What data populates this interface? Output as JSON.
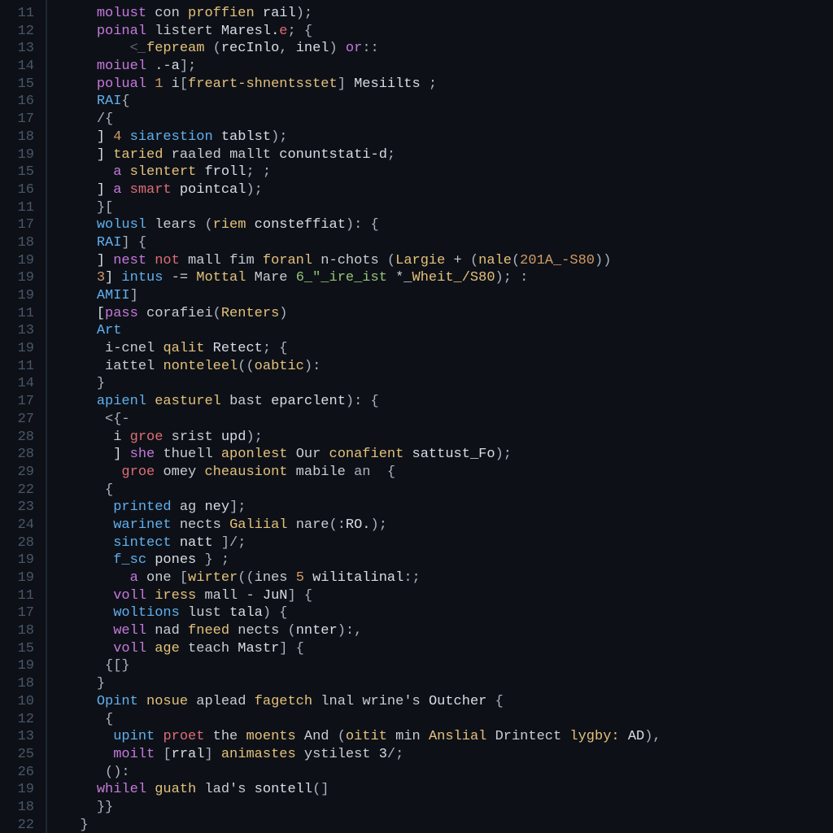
{
  "editor": {
    "gutter": [
      "11",
      "12",
      "13",
      "14",
      "15",
      "16",
      "17",
      "18",
      "19",
      "15",
      "16",
      "11",
      "17",
      "18",
      "19",
      "19",
      "19",
      "11",
      "13",
      "19",
      "11",
      "14",
      "17",
      "27",
      "28",
      "28",
      "29",
      "22",
      "23",
      "24",
      "28",
      "19",
      "19",
      "11",
      "17",
      "18",
      "15",
      "19",
      "18",
      "10",
      "12",
      "13",
      "25",
      "26",
      "19",
      "18",
      "22"
    ],
    "lines": [
      [
        [
          "    ",
          ""
        ],
        [
          "molust ",
          "kw"
        ],
        [
          "con ",
          "op"
        ],
        [
          "proffien ",
          "fn"
        ],
        [
          "rail",
          ""
        ],
        [
          ");",
          "pn"
        ]
      ],
      [
        [
          "    ",
          ""
        ],
        [
          "poinal ",
          "kw"
        ],
        [
          "listert ",
          "op"
        ],
        [
          "Maresl.",
          ""
        ],
        [
          "e",
          "id"
        ],
        [
          "; {",
          "pn"
        ]
      ],
      [
        [
          "        ",
          ""
        ],
        [
          "<_",
          "cm"
        ],
        [
          "fepream ",
          "fn"
        ],
        [
          "(",
          "pn"
        ],
        [
          "recInlo",
          ""
        ],
        [
          ", ",
          "pn"
        ],
        [
          "inel",
          ""
        ],
        [
          ") ",
          "pn"
        ],
        [
          "or",
          "kw"
        ],
        [
          "::",
          "pn"
        ]
      ],
      [
        [
          "    ",
          ""
        ],
        [
          "moiuel ",
          "kw"
        ],
        [
          ".-",
          "op"
        ],
        [
          "a",
          ""
        ],
        [
          "];",
          "pn"
        ]
      ],
      [
        [
          "    ",
          ""
        ],
        [
          "polual ",
          "kw"
        ],
        [
          "1 ",
          "num"
        ],
        [
          "i",
          "op"
        ],
        [
          "[",
          "pn"
        ],
        [
          "freart-shnentsstet",
          "fn"
        ],
        [
          "] ",
          "pn"
        ],
        [
          "Mesiilts ",
          ""
        ],
        [
          ";",
          "pn"
        ]
      ],
      [
        [
          "    ",
          ""
        ],
        [
          "RAI",
          "kw2"
        ],
        [
          "{",
          "pn"
        ]
      ],
      [
        [
          "    ",
          ""
        ],
        [
          "/{",
          "pn"
        ]
      ],
      [
        [
          "    ] ",
          ""
        ],
        [
          "4 ",
          "num"
        ],
        [
          "siarestion ",
          "kw2"
        ],
        [
          "tablst",
          ""
        ],
        [
          ");",
          "pn"
        ]
      ],
      [
        [
          "    ] ",
          ""
        ],
        [
          "taried ",
          "fn"
        ],
        [
          "raaled ",
          "op"
        ],
        [
          "mallt ",
          "op"
        ],
        [
          "conuntstati-d",
          ""
        ],
        [
          ";",
          "pn"
        ]
      ],
      [
        [
          "      ",
          ""
        ],
        [
          "a ",
          "kw"
        ],
        [
          "slentert ",
          "fn"
        ],
        [
          "froll",
          ""
        ],
        [
          "; ;",
          "pn"
        ]
      ],
      [
        [
          "    ] ",
          ""
        ],
        [
          "a ",
          "kw"
        ],
        [
          "smart ",
          "id"
        ],
        [
          "pointcal",
          ""
        ],
        [
          ");",
          "pn"
        ]
      ],
      [
        [
          "    ",
          ""
        ],
        [
          "}[",
          "pn"
        ]
      ],
      [
        [
          "    ",
          ""
        ],
        [
          "wolusl ",
          "kw2"
        ],
        [
          "lears ",
          "op"
        ],
        [
          "(",
          "pn"
        ],
        [
          "riem ",
          "fn"
        ],
        [
          "consteffiat",
          ""
        ],
        [
          "): {",
          "pn"
        ]
      ],
      [
        [
          "    ",
          ""
        ],
        [
          "RAI",
          "kw2"
        ],
        [
          "] {",
          "pn"
        ]
      ],
      [
        [
          "    ] ",
          ""
        ],
        [
          "nest ",
          "kw"
        ],
        [
          "not ",
          "id"
        ],
        [
          "mall ",
          "op"
        ],
        [
          "fim ",
          "op"
        ],
        [
          "foranl ",
          "fn"
        ],
        [
          "n-chots ",
          "op"
        ],
        [
          "(",
          "pn"
        ],
        [
          "Largie ",
          "fn"
        ],
        [
          "+ ",
          "op"
        ],
        [
          "(",
          "pn"
        ],
        [
          "nale",
          "fn"
        ],
        [
          "(",
          "pn"
        ],
        [
          "201A_-S80",
          "num"
        ],
        [
          "))",
          "pn"
        ]
      ],
      [
        [
          "    ",
          ""
        ],
        [
          "3",
          "num"
        ],
        [
          "] ",
          ""
        ],
        [
          "intus ",
          "kw2"
        ],
        [
          "-= ",
          "op"
        ],
        [
          "Mottal ",
          "fn"
        ],
        [
          "Mare ",
          "op"
        ],
        [
          "6_\"_ire_ist ",
          "str"
        ],
        [
          "*_",
          "op"
        ],
        [
          "Wheit_/S80",
          "fn"
        ],
        [
          "); :",
          "pn"
        ]
      ],
      [
        [
          "    ",
          ""
        ],
        [
          "AMII",
          "kw2"
        ],
        [
          "]",
          "pn"
        ]
      ],
      [
        [
          "    [",
          ""
        ],
        [
          "pass ",
          "kw"
        ],
        [
          "corafiei",
          "op"
        ],
        [
          "(",
          "pn"
        ],
        [
          "Renters",
          "fn"
        ],
        [
          ")",
          "pn"
        ]
      ],
      [
        [
          "    ",
          ""
        ],
        [
          "Art",
          "kw2"
        ]
      ],
      [
        [
          "     ",
          ""
        ],
        [
          "i-cnel ",
          "op"
        ],
        [
          "qalit ",
          "fn"
        ],
        [
          "Retect",
          ""
        ],
        [
          "; {",
          "pn"
        ]
      ],
      [
        [
          "     ",
          ""
        ],
        [
          "iattel ",
          "op"
        ],
        [
          "nonteleel",
          "fn"
        ],
        [
          "((",
          "pn"
        ],
        [
          "oabtic",
          "fn"
        ],
        [
          "):",
          "pn"
        ]
      ],
      [
        [
          "    ",
          ""
        ],
        [
          "}",
          "pn"
        ]
      ],
      [
        [
          "    ",
          ""
        ],
        [
          "apienl ",
          "kw2"
        ],
        [
          "easturel ",
          "fn"
        ],
        [
          "bast ",
          "op"
        ],
        [
          "eparclent",
          ""
        ],
        [
          "): {",
          "pn"
        ]
      ],
      [
        [
          "     ",
          ""
        ],
        [
          "<{-",
          "pn"
        ]
      ],
      [
        [
          "      ",
          ""
        ],
        [
          "i ",
          "op"
        ],
        [
          "groe ",
          "id"
        ],
        [
          "srist ",
          "op"
        ],
        [
          "upd",
          ""
        ],
        [
          ");",
          "pn"
        ]
      ],
      [
        [
          "      ] ",
          ""
        ],
        [
          "she ",
          "kw"
        ],
        [
          "thuell ",
          "op"
        ],
        [
          "aponlest ",
          "fn"
        ],
        [
          "Our ",
          "op"
        ],
        [
          "conafient ",
          "fn"
        ],
        [
          "sattust_Fo",
          ""
        ],
        [
          ");",
          "pn"
        ]
      ],
      [
        [
          "       ",
          ""
        ],
        [
          "groe ",
          "id"
        ],
        [
          "omey ",
          "op"
        ],
        [
          "cheausiont ",
          "fn"
        ],
        [
          "mabile ",
          "op"
        ],
        [
          "an  {",
          "pn"
        ]
      ],
      [
        [
          "     ",
          ""
        ],
        [
          "{",
          "pn"
        ]
      ],
      [
        [
          "      ",
          ""
        ],
        [
          "printed ",
          "kw2"
        ],
        [
          "ag ",
          "op"
        ],
        [
          "ney",
          ""
        ],
        [
          "];",
          "pn"
        ]
      ],
      [
        [
          "      ",
          ""
        ],
        [
          "warinet ",
          "kw2"
        ],
        [
          "nects ",
          "op"
        ],
        [
          "Galiial ",
          "fn"
        ],
        [
          "nare",
          "op"
        ],
        [
          "(:",
          "pn"
        ],
        [
          "RO.",
          ""
        ],
        [
          ");",
          "pn"
        ]
      ],
      [
        [
          "      ",
          ""
        ],
        [
          "sintect ",
          "kw2"
        ],
        [
          "natt ",
          ""
        ],
        [
          "]/;",
          "pn"
        ]
      ],
      [
        [
          "      ",
          ""
        ],
        [
          "f_sc ",
          "kw2"
        ],
        [
          "pones ",
          ""
        ],
        [
          "} ;",
          "pn"
        ]
      ],
      [
        [
          "        ",
          ""
        ],
        [
          "a ",
          "kw"
        ],
        [
          "one ",
          "op"
        ],
        [
          "[",
          "pn"
        ],
        [
          "wirter",
          "fn"
        ],
        [
          "((",
          "pn"
        ],
        [
          "ines ",
          "op"
        ],
        [
          "5 ",
          "num"
        ],
        [
          "wilitalinal",
          ""
        ],
        [
          ":;",
          "pn"
        ]
      ],
      [
        [
          "      ",
          ""
        ],
        [
          "voll ",
          "kw"
        ],
        [
          "iress ",
          "fn"
        ],
        [
          "mall ",
          "op"
        ],
        [
          "- ",
          "op"
        ],
        [
          "JuN",
          ""
        ],
        [
          "] {",
          "pn"
        ]
      ],
      [
        [
          "      ",
          ""
        ],
        [
          "woltions ",
          "kw2"
        ],
        [
          "lust ",
          "op"
        ],
        [
          "tala",
          ""
        ],
        [
          ") {",
          "pn"
        ]
      ],
      [
        [
          "      ",
          ""
        ],
        [
          "well ",
          "kw"
        ],
        [
          "nad ",
          "op"
        ],
        [
          "fneed ",
          "fn"
        ],
        [
          "nects ",
          "op"
        ],
        [
          "(",
          "pn"
        ],
        [
          "nnter",
          ""
        ],
        [
          "):,",
          "pn"
        ]
      ],
      [
        [
          "      ",
          ""
        ],
        [
          "voll ",
          "kw"
        ],
        [
          "age ",
          "fn"
        ],
        [
          "teach ",
          "op"
        ],
        [
          "Mastr",
          ""
        ],
        [
          "] {",
          "pn"
        ]
      ],
      [
        [
          "     ",
          ""
        ],
        [
          "{[}",
          "pn"
        ]
      ],
      [
        [
          "    ",
          ""
        ],
        [
          "}",
          "pn"
        ]
      ],
      [
        [
          "    ",
          ""
        ],
        [
          "Opint ",
          "kw2"
        ],
        [
          "nosue ",
          "fn"
        ],
        [
          "aplead ",
          "op"
        ],
        [
          "fagetch ",
          "fn"
        ],
        [
          "lnal ",
          "op"
        ],
        [
          "wrine's ",
          "op"
        ],
        [
          "Outcher ",
          ""
        ],
        [
          "{",
          "pn"
        ]
      ],
      [
        [
          "     ",
          ""
        ],
        [
          "{",
          "pn"
        ]
      ],
      [
        [
          "      ",
          ""
        ],
        [
          "upint ",
          "kw2"
        ],
        [
          "proet ",
          "id"
        ],
        [
          "the ",
          "op"
        ],
        [
          "moents ",
          "fn"
        ],
        [
          "And ",
          "op"
        ],
        [
          "(",
          "pn"
        ],
        [
          "oitit ",
          "fn"
        ],
        [
          "min ",
          "op"
        ],
        [
          "Anslial ",
          "fn"
        ],
        [
          "Drintect ",
          "op"
        ],
        [
          "lygby: ",
          "fn"
        ],
        [
          "AD",
          ""
        ],
        [
          "),",
          "pn"
        ]
      ],
      [
        [
          "      ",
          ""
        ],
        [
          "moilt ",
          "kw"
        ],
        [
          "[",
          "pn"
        ],
        [
          "rral",
          ""
        ],
        [
          "] ",
          "pn"
        ],
        [
          "animastes ",
          "fn"
        ],
        [
          "ystilest ",
          "op"
        ],
        [
          "3",
          ""
        ],
        [
          "/;",
          "pn"
        ]
      ],
      [
        [
          "     ",
          ""
        ],
        [
          "():",
          "pn"
        ]
      ],
      [
        [
          "    ",
          ""
        ],
        [
          "whilel ",
          "kw"
        ],
        [
          "guath ",
          "fn"
        ],
        [
          "lad's ",
          "op"
        ],
        [
          "sontell",
          ""
        ],
        [
          "(]",
          "pn"
        ]
      ],
      [
        [
          "    ",
          ""
        ],
        [
          "}}",
          "pn"
        ]
      ],
      [
        [
          "  ",
          ""
        ],
        [
          "}",
          "pn"
        ]
      ]
    ]
  }
}
